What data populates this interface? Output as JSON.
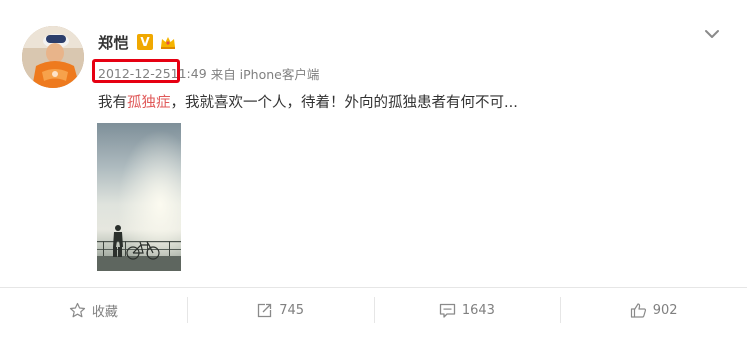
{
  "post": {
    "author": {
      "name": "郑恺",
      "verified_badge": "V",
      "badge_color": "#f0a800"
    },
    "meta": {
      "date": "2012-12-25",
      "time": " 11:49",
      "source": "来自 iPhone客户端"
    },
    "content": {
      "prefix": "我有",
      "topic_link": "孤独症",
      "suffix": "，我就喜欢一个人，待着！外向的孤独患者有何不可..."
    },
    "colors": {
      "highlight_box": "#e60012",
      "topic_link": "#e05a5a",
      "meta_text": "#808080"
    },
    "icons": {
      "chevron": "chevron-down-icon",
      "crown": "crown-icon",
      "favorite": "star-icon",
      "repost": "repost-icon",
      "comment": "comment-icon",
      "like": "thumbs-up-icon"
    }
  },
  "actions": {
    "favorite_label": "收藏",
    "repost_count": "745",
    "comment_count": "1643",
    "like_count": "902"
  }
}
